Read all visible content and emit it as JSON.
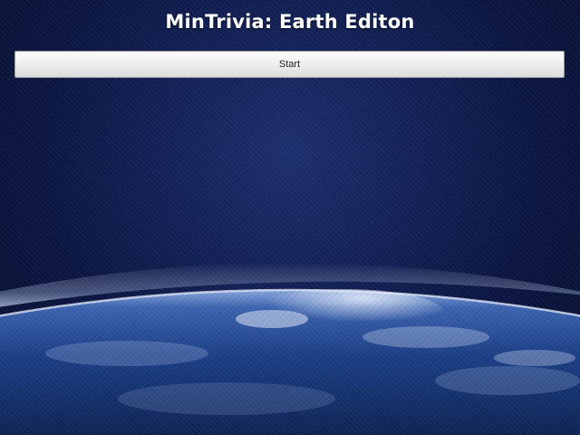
{
  "app": {
    "title": "MinTrivia: Earth Editon"
  },
  "menu": {
    "start_label": "Start"
  },
  "background": {
    "description_icon": "earth-from-space-image",
    "space_color": "#0c1642",
    "atmosphere_color": "#9fb6e8",
    "earth_color": "#1c3f86"
  }
}
